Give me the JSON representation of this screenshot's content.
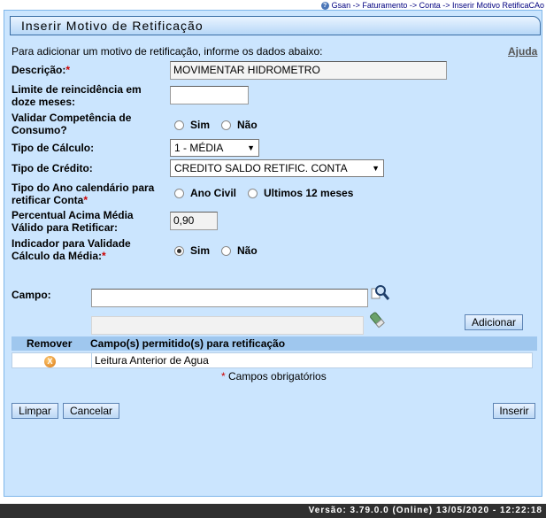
{
  "breadcrumb": "Gsan -> Faturamento -> Conta -> Inserir Motivo RetificaCAo",
  "title": "Inserir Motivo de Retificação",
  "intro": "Para adicionar um motivo de retificação, informe os dados abaixo:",
  "help_link": "Ajuda",
  "required_marker": "*",
  "fields": {
    "descricao": {
      "label": "Descrição:",
      "value": "MOVIMENTAR HIDROMETRO"
    },
    "limite": {
      "label_1": "Limite de reincidência em",
      "label_2": "doze meses:",
      "value": ""
    },
    "validar": {
      "label_1": "Validar Competência de",
      "label_2": "Consumo?",
      "opt_sim": "Sim",
      "opt_nao": "Não",
      "selected": ""
    },
    "tipo_calculo": {
      "label": "Tipo de Cálculo:",
      "value": "1 - MÉDIA"
    },
    "tipo_credito": {
      "label": "Tipo de Crédito:",
      "value": "CREDITO SALDO RETIFIC. CONTA"
    },
    "tipo_ano": {
      "label_1": "Tipo do Ano calendário para",
      "label_2": "retificar Conta",
      "opt_civil": "Ano Civil",
      "opt_12": "Ultimos 12 meses",
      "selected": ""
    },
    "percentual": {
      "label_1": "Percentual Acima Média",
      "label_2": "Válido para Retificar:",
      "value": "0,90"
    },
    "indicador": {
      "label_1": "Indicador para Validade",
      "label_2": "Cálculo da Média:",
      "opt_sim": "Sim",
      "opt_nao": "Não",
      "selected": "sim"
    },
    "campo": {
      "label": "Campo:",
      "value": "",
      "desc_value": ""
    }
  },
  "buttons": {
    "adicionar": "Adicionar",
    "limpar": "Limpar",
    "cancelar": "Cancelar",
    "inserir": "Inserir"
  },
  "table": {
    "headers": [
      "Remover",
      "Campo(s) permitido(s) para retificação"
    ],
    "rows": [
      {
        "campo": "Leitura Anterior de Agua"
      }
    ]
  },
  "required_note": "Campos obrigatórios",
  "footer": "Versão: 3.79.0.0 (Online) 13/05/2020 - 12:22:18",
  "colors": {
    "panel": "#cbe5fe",
    "header": "#9fc7ee",
    "footer": "#303030",
    "required": "#cc0000"
  }
}
